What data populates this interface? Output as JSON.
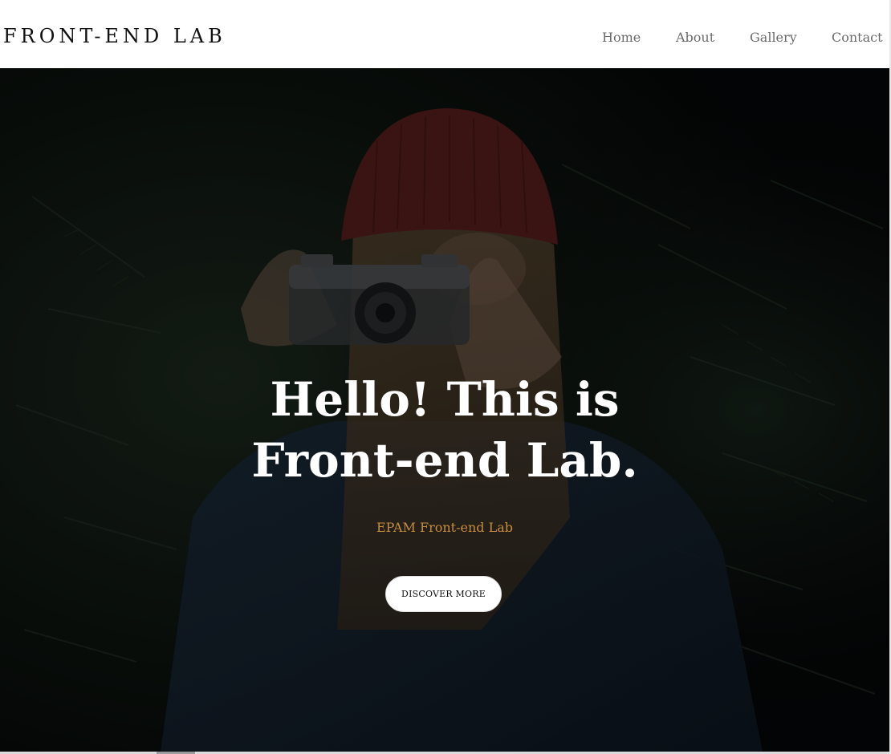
{
  "header": {
    "logo": "FRONT-END LAB",
    "nav": [
      {
        "label": "Home"
      },
      {
        "label": "About"
      },
      {
        "label": "Gallery"
      },
      {
        "label": "Contact"
      }
    ]
  },
  "hero": {
    "title_line1": "Hello! This is",
    "title_line2": "Front-end Lab.",
    "subtitle": "EPAM Front-end Lab",
    "cta_label": "DISCOVER MORE",
    "background_image": "photographer-with-camera-red-beanie"
  },
  "colors": {
    "accent": "#c68d3c",
    "hero_overlay": "#05080a",
    "nav_text": "#6b6b6b"
  }
}
